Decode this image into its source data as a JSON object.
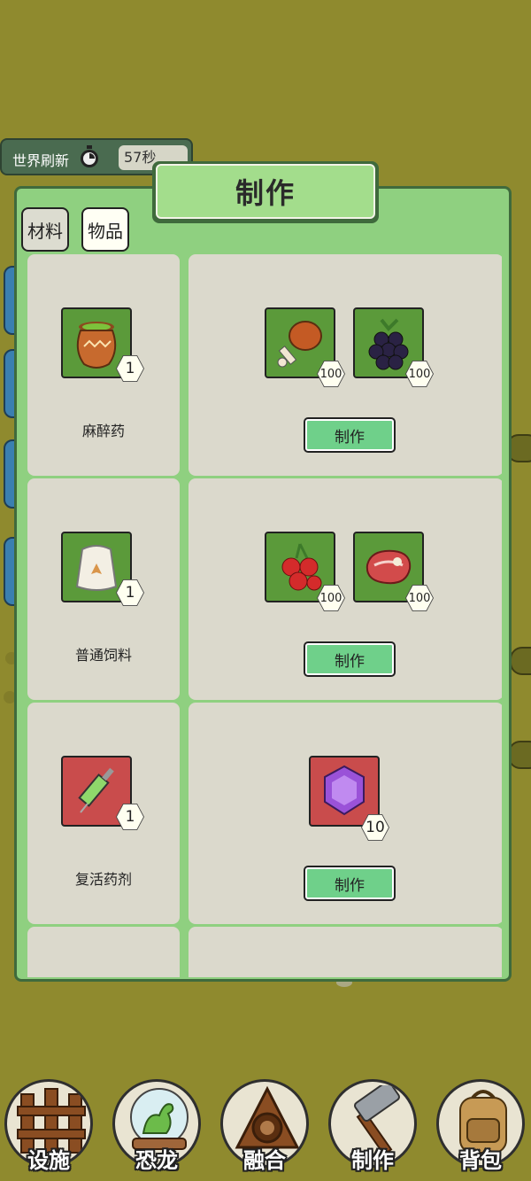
{
  "world_refresh": {
    "label": "世界刷新",
    "time": "57秒",
    "icon": "stopwatch-icon"
  },
  "panel": {
    "title": "制作"
  },
  "tabs": [
    {
      "label": "材料",
      "active": false
    },
    {
      "label": "物品",
      "active": true
    }
  ],
  "recipes": [
    {
      "product": {
        "name": "麻醉药",
        "icon": "clay-pot-potion-icon",
        "qty": "1",
        "frame": "green"
      },
      "materials": [
        {
          "icon": "roast-drumstick-icon",
          "qty": "100",
          "frame": "green"
        },
        {
          "icon": "blackberry-icon",
          "qty": "100",
          "frame": "green"
        }
      ],
      "button": "制作"
    },
    {
      "product": {
        "name": "普通饲料",
        "icon": "feed-sack-icon",
        "qty": "1",
        "frame": "green"
      },
      "materials": [
        {
          "icon": "red-berries-icon",
          "qty": "100",
          "frame": "green"
        },
        {
          "icon": "raw-steak-icon",
          "qty": "100",
          "frame": "green"
        }
      ],
      "button": "制作"
    },
    {
      "product": {
        "name": "复活药剂",
        "icon": "syringe-icon",
        "qty": "1",
        "frame": "red"
      },
      "materials": [
        {
          "icon": "purple-gem-icon",
          "qty": "10",
          "frame": "red"
        }
      ],
      "button": "制作"
    }
  ],
  "nav": [
    {
      "label": "设施",
      "icon": "wooden-fence-icon"
    },
    {
      "label": "恐龙",
      "icon": "dinosaur-globe-icon"
    },
    {
      "label": "融合",
      "icon": "fusion-triangle-icon"
    },
    {
      "label": "制作",
      "icon": "hammer-icon"
    },
    {
      "label": "背包",
      "icon": "backpack-icon"
    }
  ]
}
